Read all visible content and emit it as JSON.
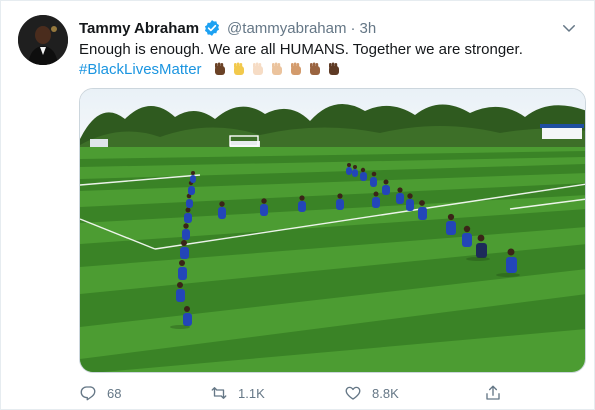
{
  "tweet": {
    "author_name": "Tammy Abraham",
    "handle": "@tammyabraham",
    "separator": "·",
    "time": "3h",
    "text_line1": "Enough is enough. We are all HUMANS. Together we are stronger.",
    "hashtag": "#BlackLivesMatter",
    "fist_emoji_tones": [
      "#6b4226",
      "#f2c94c",
      "#f6dcc5",
      "#ebc39d",
      "#d39b6c",
      "#9a6440",
      "#5e3a24"
    ],
    "media_alt": "Players kneeling on a training pitch forming a large H shape"
  },
  "actions": {
    "replies": "68",
    "retweets": "1.1K",
    "likes": "8.8K"
  },
  "colors": {
    "link": "#1b95e0",
    "verified": "#1da1f2",
    "muted": "#657786",
    "grass_light": "#4c9c32",
    "grass_dark": "#3a8326",
    "kit": "#2346b8"
  }
}
